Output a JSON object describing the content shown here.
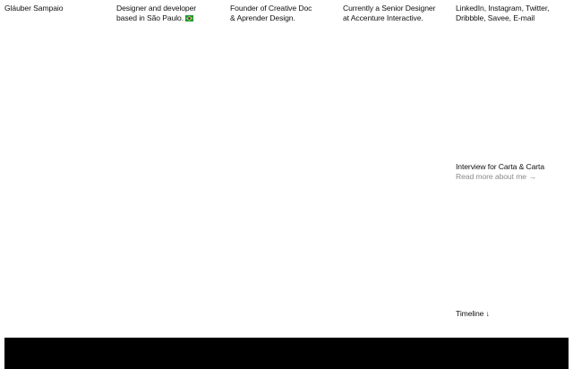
{
  "header": {
    "name": "Gláuber Sampaio",
    "bio": {
      "line1": "Designer and developer",
      "line2": "based in São Paulo."
    },
    "founder": {
      "line1": "Founder of Creative Doc",
      "line2": "& Aprender Design."
    },
    "current": {
      "line1": "Currently a Senior Designer",
      "line2": "at Accenture Interactive."
    },
    "social": {
      "linkedin": "LinkedIn",
      "instagram": "Instagram",
      "twitter": "Twitter",
      "dribbble": "Dribbble",
      "savee": "Savee",
      "email": "E-mail"
    }
  },
  "interview": {
    "title": "Interview for Carta & Carta",
    "read_more": "Read more about me →"
  },
  "timeline": {
    "label": "Timeline ↓"
  },
  "colors": {
    "text": "#111111",
    "muted": "#8a8a8a",
    "footer": "#000000",
    "flag_green": "#1c9a3e",
    "flag_yellow": "#f2d21b",
    "flag_blue": "#1a3d8f"
  },
  "icons": {
    "flag": "brazil-flag-icon"
  }
}
